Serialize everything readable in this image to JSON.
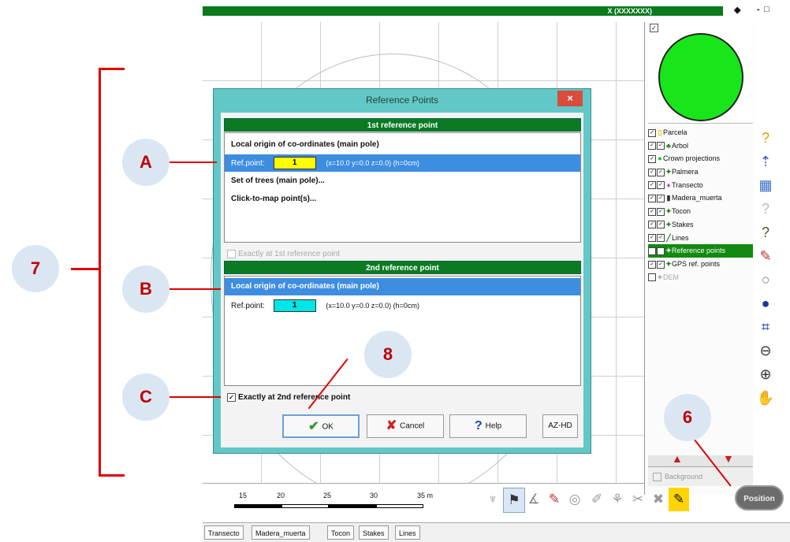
{
  "topbar": {
    "status_text": "X (XXXXXXX)",
    "btn_arrow": "◆",
    "btn_min": "-",
    "btn_restore": "□"
  },
  "dialog": {
    "title": "Reference Points",
    "close_label": "×",
    "first": {
      "header": "1st reference point",
      "rows": [
        "Local origin of co-ordinates (main pole)",
        "Set of trees (main pole)...",
        "Click-to-map point(s)..."
      ],
      "refpoint_label": "Ref.point:",
      "refpoint_value": "1",
      "refpoint_info": "(x=10.0  y=0.0  z=0.0)  (h=0cm)",
      "exact_label": "Exactly at 1st reference point"
    },
    "second": {
      "header": "2nd reference point",
      "row": "Local origin of co-ordinates (main pole)",
      "refpoint_label": "Ref.point:",
      "refpoint_value": "1",
      "refpoint_info": "(x=10.0  y=0.0  z=0.0)  (h=0cm)",
      "exact_label": "Exactly at 2nd reference point"
    },
    "buttons": {
      "ok": "OK",
      "cancel": "Cancel",
      "help": "Help",
      "az": "AZ-HD"
    }
  },
  "layers": [
    {
      "name": "Parcela",
      "checks": "✓",
      "state": "normal"
    },
    {
      "name": "Arbol",
      "checks": "✓✓",
      "state": "normal"
    },
    {
      "name": "Crown projections",
      "checks": "✓",
      "state": "normal"
    },
    {
      "name": "Palmera",
      "checks": "✓✓",
      "state": "normal"
    },
    {
      "name": "Transecto",
      "checks": "✓✓",
      "state": "normal"
    },
    {
      "name": "Madera_muerta",
      "checks": "✓✓",
      "state": "normal"
    },
    {
      "name": "Tocon",
      "checks": "✓✓",
      "state": "normal"
    },
    {
      "name": "Stakes",
      "checks": "✓✓",
      "state": "normal"
    },
    {
      "name": "Lines",
      "checks": "✓✓",
      "state": "normal"
    },
    {
      "name": "Reference points",
      "checks": "✓✓",
      "state": "selected"
    },
    {
      "name": "GPS ref. points",
      "checks": "✓✓",
      "state": "normal"
    },
    {
      "name": "DEM",
      "checks": "",
      "state": "dim"
    }
  ],
  "background_label": "Background",
  "scale": {
    "ticks": [
      "15",
      "20",
      "25",
      "30",
      "35 m"
    ]
  },
  "position_button": "Position",
  "tabs": [
    "Transecto",
    "Madera_muerta",
    "Tocon",
    "Stakes",
    "Lines"
  ],
  "annotations": {
    "a": "A",
    "b": "B",
    "c": "C",
    "six": "6",
    "seven": "7",
    "eight": "8"
  },
  "colors": {
    "accent_green": "#0c7a22",
    "selection_blue": "#3d8de0",
    "ref1_yellow": "#ffff00",
    "ref2_cyan": "#00e5e5",
    "annotation_red": "#e00000",
    "dialog_teal": "#62c7c7"
  }
}
